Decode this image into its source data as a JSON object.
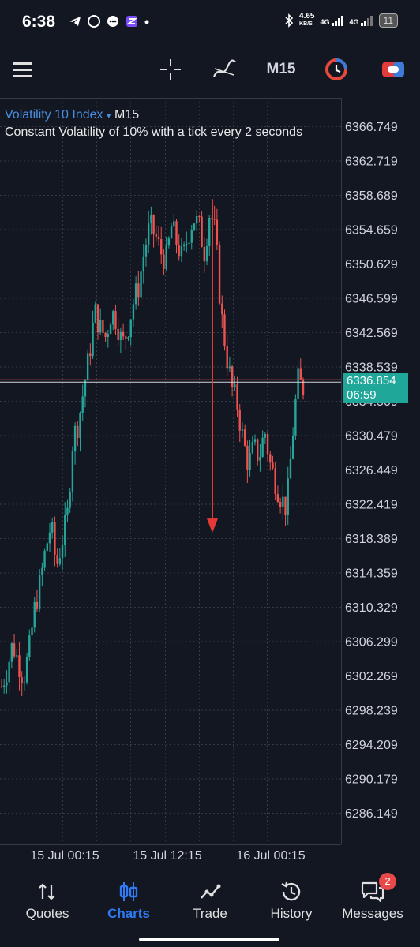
{
  "status_bar": {
    "time": "6:38",
    "net_speed": "4.65",
    "net_unit": "KB/S",
    "signal1": "4G",
    "signal2": "4G",
    "battery": "11"
  },
  "toolbar": {
    "menu_icon": "hamburger-icon",
    "crosshair_icon": "crosshair-icon",
    "indicators_icon": "indicators-icon",
    "timeframe": "M15",
    "clock_icon": "clock-icon",
    "trade_icon": "trade-toggle-icon"
  },
  "chart": {
    "symbol": "Volatility 10 Index",
    "dropdown_glyph": "▾",
    "timeframe": "M15",
    "description": "Constant Volatility of 10% with a tick every 2 seconds",
    "price_labels": [
      "6366.749",
      "6362.719",
      "6358.689",
      "6354.659",
      "6350.629",
      "6346.599",
      "6342.569",
      "6338.539",
      "6334.509",
      "6330.479",
      "6326.449",
      "6322.419",
      "6318.389",
      "6314.359",
      "6310.329",
      "6306.299",
      "6302.269",
      "6298.239",
      "6294.209",
      "6290.179",
      "6286.149"
    ],
    "current_price": "6336.854",
    "countdown": "06:59",
    "time_labels": [
      "15 Jul 00:15",
      "15 Jul 12:15",
      "16 Jul 00:15"
    ],
    "colors": {
      "up": "#26a69a",
      "down": "#ef5350",
      "arrow": "#e53935",
      "background": "#131722",
      "grid": "#363a45"
    }
  },
  "chart_data": {
    "type": "candlestick",
    "title": "Volatility 10 Index",
    "timeframe": "M15",
    "ylim": [
      6284.0,
      6370.0
    ],
    "y_ticks": [
      6366.749,
      6362.719,
      6358.689,
      6354.659,
      6350.629,
      6346.599,
      6342.569,
      6338.539,
      6334.509,
      6330.479,
      6326.449,
      6322.419,
      6318.389,
      6314.359,
      6310.329,
      6306.299,
      6302.269,
      6298.239,
      6294.209,
      6290.179,
      6286.149
    ],
    "x_tick_labels": [
      "15 Jul 00:15",
      "15 Jul 12:15",
      "16 Jul 00:15"
    ],
    "current_price": 6336.854,
    "close_path": [
      6301,
      6303,
      6306,
      6304,
      6302,
      6305,
      6310,
      6313,
      6317,
      6320,
      6315,
      6318,
      6321,
      6330,
      6332,
      6336,
      6340,
      6345,
      6343,
      6342,
      6345,
      6344,
      6341,
      6343,
      6346,
      6348,
      6352,
      6355,
      6354,
      6352,
      6351,
      6355,
      6353,
      6351,
      6354,
      6356,
      6355,
      6352,
      6357,
      6354,
      6345,
      6340,
      6336,
      6334,
      6330,
      6327,
      6329,
      6328,
      6331,
      6327,
      6325,
      6323,
      6322,
      6330,
      6337,
      6336
    ],
    "annotation": "downward red arrow from 6358 to 6319"
  },
  "bottom_nav": {
    "items": [
      {
        "label": "Quotes",
        "icon": "quotes-arrows-icon"
      },
      {
        "label": "Charts",
        "icon": "charts-candles-icon"
      },
      {
        "label": "Trade",
        "icon": "trade-line-icon"
      },
      {
        "label": "History",
        "icon": "history-clock-icon"
      },
      {
        "label": "Messages",
        "icon": "messages-chat-icon",
        "badge": "2"
      }
    ],
    "active": "Charts"
  }
}
